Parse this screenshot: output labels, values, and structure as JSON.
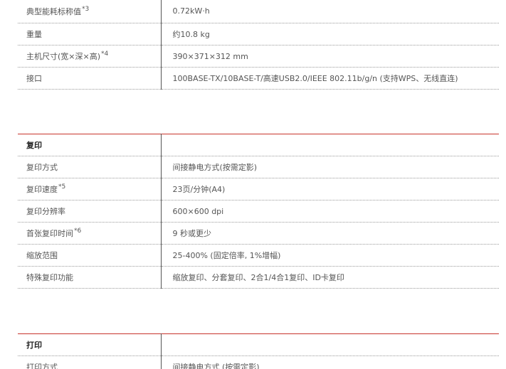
{
  "spec_sections": [
    {
      "rows": [
        {
          "label": "典型能耗标称值",
          "note": "*3",
          "value": "0.72kW·h"
        },
        {
          "label": "重量",
          "note": "",
          "value": "约10.8 kg"
        },
        {
          "label": "主机尺寸(宽×深×高)",
          "note": "*4",
          "value": "390×371×312 mm"
        },
        {
          "label": "接口",
          "note": "",
          "value": "100BASE-TX/10BASE-T/高速USB2.0/IEEE 802.11b/g/n (支持WPS、无线直连)"
        }
      ]
    },
    {
      "title": "复印",
      "rows": [
        {
          "label": "复印方式",
          "note": "",
          "value": "间接静电方式(按需定影)"
        },
        {
          "label": "复印速度",
          "note": "*5",
          "value": "23页/分钟(A4)"
        },
        {
          "label": "复印分辨率",
          "note": "",
          "value": "600×600 dpi"
        },
        {
          "label": "首张复印时间",
          "note": "*6",
          "value": "9 秒或更少"
        },
        {
          "label": "缩放范围",
          "note": "",
          "value": "25-400% (固定倍率, 1%增幅)"
        },
        {
          "label": "特殊复印功能",
          "note": "",
          "value": "缩放复印、分套复印、2合1/4合1复印、ID卡复印"
        }
      ]
    },
    {
      "title": "打印",
      "rows": [
        {
          "label": "打印方式",
          "note": "",
          "value": "间接静电方式 (按需定影)"
        }
      ]
    }
  ]
}
